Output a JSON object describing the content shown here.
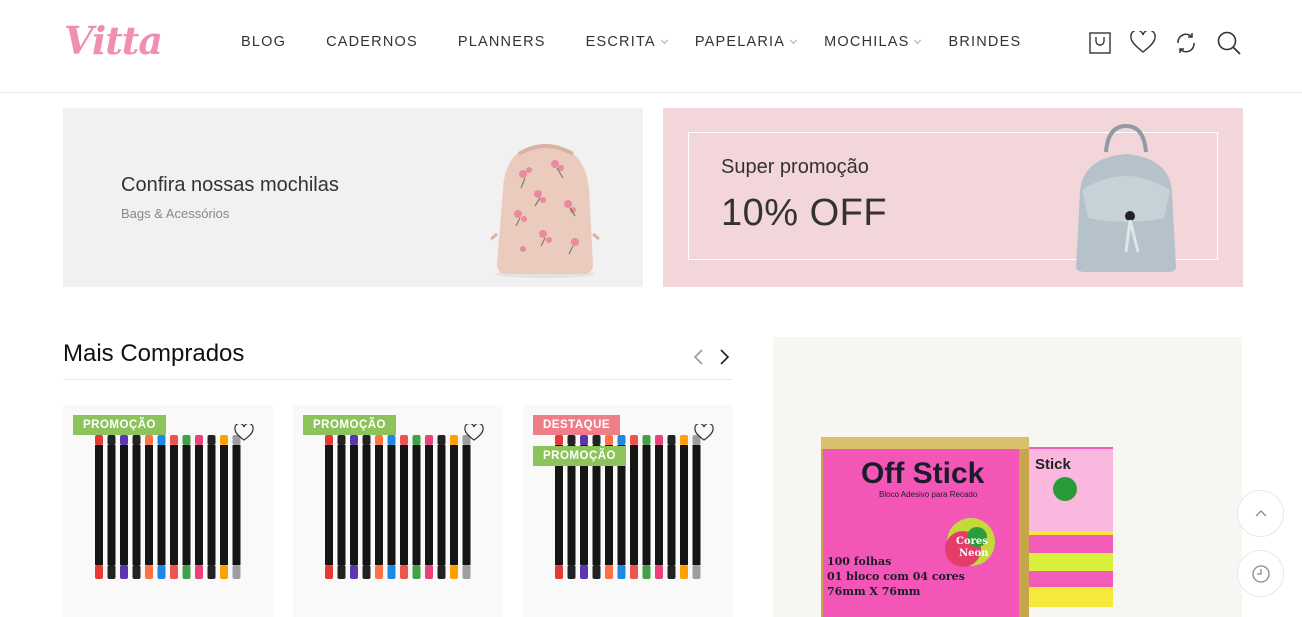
{
  "header": {
    "logo": "Vitta",
    "nav": [
      {
        "label": "BLOG",
        "has_submenu": false
      },
      {
        "label": "CADERNOS",
        "has_submenu": false
      },
      {
        "label": "PLANNERS",
        "has_submenu": false
      },
      {
        "label": "ESCRITA",
        "has_submenu": true
      },
      {
        "label": "PAPELARIA",
        "has_submenu": true
      },
      {
        "label": "MOCHILAS",
        "has_submenu": true
      },
      {
        "label": "BRINDES",
        "has_submenu": false
      }
    ],
    "icons": [
      "cart-icon",
      "heart-icon",
      "compare-icon",
      "search-icon"
    ]
  },
  "banners": {
    "left": {
      "title": "Confira nossas mochilas",
      "subtitle": "Bags & Acessórios"
    },
    "right": {
      "title": "Super promoção",
      "big": "10% OFF"
    }
  },
  "section": {
    "title": "Mais Comprados"
  },
  "products": [
    {
      "badges": [
        "PROMOÇÃO"
      ]
    },
    {
      "badges": [
        "PROMOÇÃO"
      ]
    },
    {
      "badges": [
        "DESTAQUE",
        "PROMOÇÃO"
      ]
    }
  ],
  "badge_labels": {
    "promo": "PROMOÇÃO",
    "highlight": "DESTAQUE"
  },
  "promo_image": {
    "brand": "Off Stick",
    "tagline": "Bloco Adesivo para Recado",
    "line1": "100 folhas",
    "line2": "01 bloco com 04 cores",
    "line3": "76mm X 76mm",
    "sticker_top": "Cores",
    "sticker_bottom": "Neon",
    "back_brand": "Stick"
  },
  "colors": {
    "accent": "#ef8fb3",
    "promo_badge": "#8cc35a",
    "highlight_badge": "#ef7e88",
    "banner_pink": "#f3d6d9",
    "banner_gray": "#f1f1f1"
  }
}
